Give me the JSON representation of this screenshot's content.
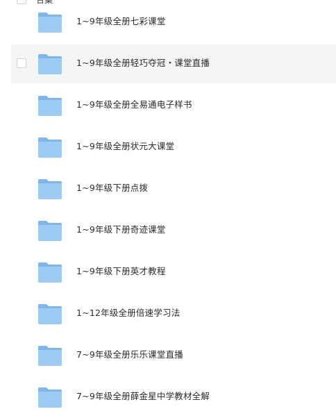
{
  "colors": {
    "folder_back": "#7fb6ea",
    "folder_front": "#9ecbf5",
    "hover_row": "#f4f5f6",
    "text": "#2b2b2b"
  },
  "icons": {
    "folder": "folder-icon",
    "checkbox": "checkbox-icon"
  },
  "top": {
    "label": "合集"
  },
  "files": [
    {
      "name": "1~9年级全册七彩课堂"
    },
    {
      "name": "1~9年级全册轻巧夺冠・课堂直播"
    },
    {
      "name": "1~9年级全册全易通电子样书"
    },
    {
      "name": "1~9年级全册状元大课堂"
    },
    {
      "name": "1~9年级下册点拨"
    },
    {
      "name": "1~9年级下册奇迹课堂"
    },
    {
      "name": "1~9年级下册英才教程"
    },
    {
      "name": "1~12年级全册倍速学习法"
    },
    {
      "name": "7~9年级全册乐乐课堂直播"
    },
    {
      "name": "7~9年级全册薛金星中学教材全解"
    }
  ]
}
